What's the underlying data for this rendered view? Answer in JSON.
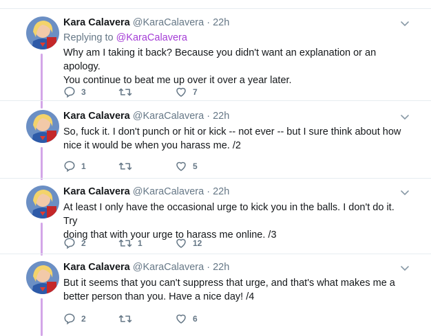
{
  "tweets": [
    {
      "name": "Kara Calavera",
      "handle": "@KaraCalavera",
      "dot": "·",
      "time": "22h",
      "reply_prefix": "Replying to ",
      "reply_handle": "@KaraCalavera",
      "lines": [
        "Why am I taking it back? Because you didn't want an explanation or an apology.",
        "You continue to beat me up over it over a year later."
      ],
      "replies": "3",
      "retweets": "",
      "likes": "7"
    },
    {
      "name": "Kara Calavera",
      "handle": "@KaraCalavera",
      "dot": "·",
      "time": "22h",
      "lines": [
        "So, fuck it. I don't punch or hit or kick -- not ever -- but I sure think about how",
        "nice it would be when you harass me. /2"
      ],
      "replies": "1",
      "retweets": "",
      "likes": "5"
    },
    {
      "name": "Kara Calavera",
      "handle": "@KaraCalavera",
      "dot": "·",
      "time": "22h",
      "lines": [
        "At least I only have the occasional urge to kick you in the balls. I don't do it. Try",
        "doing that with your urge to harass me online. /3"
      ],
      "replies": "2",
      "retweets": "1",
      "likes": "12"
    },
    {
      "name": "Kara Calavera",
      "handle": "@KaraCalavera",
      "dot": "·",
      "time": "22h",
      "lines": [
        "But it seems that you can't suppress that urge, and that's what makes me a",
        "better person than you. Have a nice day! /4"
      ],
      "replies": "2",
      "retweets": "",
      "likes": "6"
    }
  ],
  "colors": {
    "thread": "#d3a6e8",
    "link": "#a43cd6",
    "muted": "#657786"
  },
  "icons": [
    "reply-icon",
    "retweet-icon",
    "like-icon",
    "chevron-down-icon",
    "avatar"
  ]
}
